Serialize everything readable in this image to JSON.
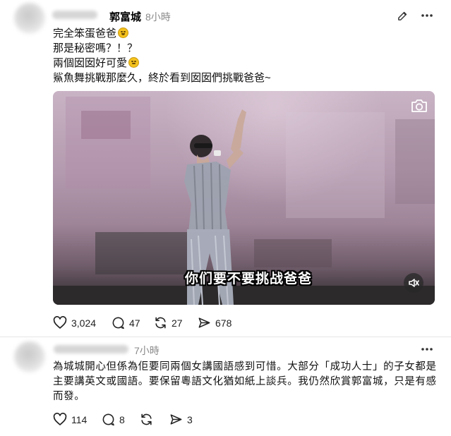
{
  "post": {
    "author": "郭富城",
    "separator": "·",
    "time": "8小時",
    "lines": [
      "完全笨蛋爸爸",
      "那是秘密嗎？！？",
      "兩個囡囡好可愛",
      "鯊魚舞挑戰那麼久，終於看到囡囡們挑戰爸爸~"
    ],
    "emojis": [
      "rolling-laughing-face-emoji",
      "smiling-face-emoji"
    ],
    "video": {
      "subtitle": "你们要不要挑战爸爸",
      "camera_icon": "camera-icon",
      "mute_icon": "speaker-muted-icon"
    },
    "stats": {
      "likes": "3,024",
      "comments": "47",
      "reposts": "27",
      "shares": "678"
    }
  },
  "reply": {
    "time": "7小時",
    "text": "為城城開心但係為佢要同兩個女講國語感到可惜。大部分「成功人士」的子女都是主要講英文或國語。要保留粵語文化猶如紙上談兵。我仍然欣賞郭富城，只是有感而發。",
    "stats": {
      "likes": "114",
      "comments": "8",
      "reposts": "",
      "shares": "3"
    }
  },
  "colors": {
    "text": "#111111",
    "muted": "#8a8a8a",
    "divider": "#e6e6e6"
  }
}
